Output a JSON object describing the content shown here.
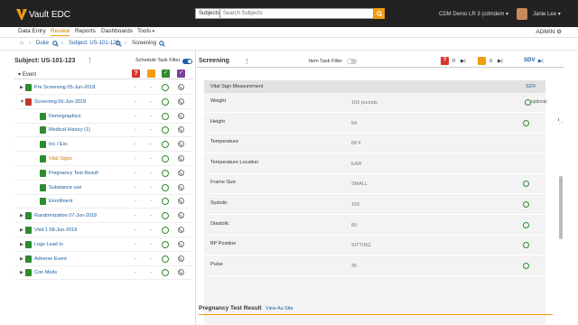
{
  "app": {
    "name": "Vault EDC"
  },
  "search": {
    "scope": "Subjects",
    "placeholder": "Search Subjects"
  },
  "header": {
    "study": "CDM Demo LR 3 (cdmdem",
    "user": "Janie Lee"
  },
  "menu": {
    "items": [
      "Data Entry",
      "Review",
      "Reports",
      "Dashboards",
      "Tools"
    ],
    "active": "Review",
    "admin": "ADMIN"
  },
  "breadcrumb": {
    "site": "Duke",
    "subject": "Subject: US-101-123",
    "event": "Screening"
  },
  "left": {
    "title": "Subject: US-101-123",
    "filter_label": "Schedule Task Filter",
    "column_label": "Event",
    "rows": [
      {
        "name": "Pre Screening 05-Jun-2018",
        "indent": 0,
        "caret": "right",
        "doc": "green",
        "a": "-",
        "b": "-"
      },
      {
        "name": "Screening 06-Jun-2018",
        "indent": 0,
        "caret": "down",
        "doc": "red",
        "a": "-",
        "b": "-"
      },
      {
        "name": "Demographics",
        "indent": 1,
        "doc": "green",
        "a": "-",
        "b": "-"
      },
      {
        "name": "Medical History (1)",
        "indent": 1,
        "doc": "green",
        "a": "-",
        "b": "-"
      },
      {
        "name": "Inc / Exc",
        "indent": 1,
        "doc": "green",
        "a": "-",
        "b": "-"
      },
      {
        "name": "Vital Signs",
        "indent": 1,
        "doc": "green",
        "a": "-",
        "b": "-",
        "highlight": true
      },
      {
        "name": "Pregnancy Test Result",
        "indent": 1,
        "doc": "green",
        "a": "-",
        "b": "-"
      },
      {
        "name": "Substance use",
        "indent": 1,
        "doc": "green",
        "a": "-",
        "b": "-"
      },
      {
        "name": "Enrollment",
        "indent": 1,
        "doc": "green",
        "a": "-",
        "b": "-"
      },
      {
        "name": "Randomization 07-Jun-2018",
        "indent": 0,
        "caret": "right",
        "doc": "green",
        "a": "-",
        "b": "-"
      },
      {
        "name": "Visit 1 08-Jun-2018",
        "indent": 0,
        "caret": "right",
        "doc": "green",
        "a": "-",
        "b": "-"
      },
      {
        "name": "Logs Lead In",
        "indent": 0,
        "caret": "right",
        "doc": "green",
        "a": "-",
        "b": "-"
      },
      {
        "name": "Adverse Event",
        "indent": 0,
        "caret": "right",
        "doc": "green",
        "a": "-",
        "b": "-"
      },
      {
        "name": "Con Meds",
        "indent": 0,
        "caret": "right",
        "doc": "green",
        "a": "-",
        "b": "-"
      }
    ]
  },
  "right": {
    "title": "Screening",
    "filter_label": "Item Task Filter",
    "query_count": "0",
    "comment_count": "0",
    "sdv_label": "SDV",
    "form": {
      "section": "Vital Sign Measurement",
      "section_sdv": "SDV",
      "rows": [
        {
          "label": "Weight",
          "value": "109 pounds",
          "status": "optional",
          "status_text": "optional"
        },
        {
          "label": "Height",
          "value": "54",
          "status": "circle"
        },
        {
          "label": "Temperature",
          "value": "88 F",
          "status": "none"
        },
        {
          "label": "Temperature Location",
          "value": "EAR",
          "status": "none"
        },
        {
          "label": "Frame Size",
          "value": "SMALL",
          "status": "circle"
        },
        {
          "label": "Systolic",
          "value": "150",
          "status": "circle"
        },
        {
          "label": "Diastolic",
          "value": "80",
          "status": "circle"
        },
        {
          "label": "BP Position",
          "value": "SITTING",
          "status": "circle"
        },
        {
          "label": "Pulse",
          "value": "35",
          "status": "circle"
        }
      ]
    },
    "next_section": {
      "title": "Pregnancy Test Result",
      "link": "View As Site"
    }
  },
  "colors": {
    "accent": "#f39c12",
    "link": "#1a5c9e",
    "green": "#2e8b2e",
    "query": "#d9342b",
    "comment": "#f39c12",
    "review": "#7b3fa0"
  }
}
